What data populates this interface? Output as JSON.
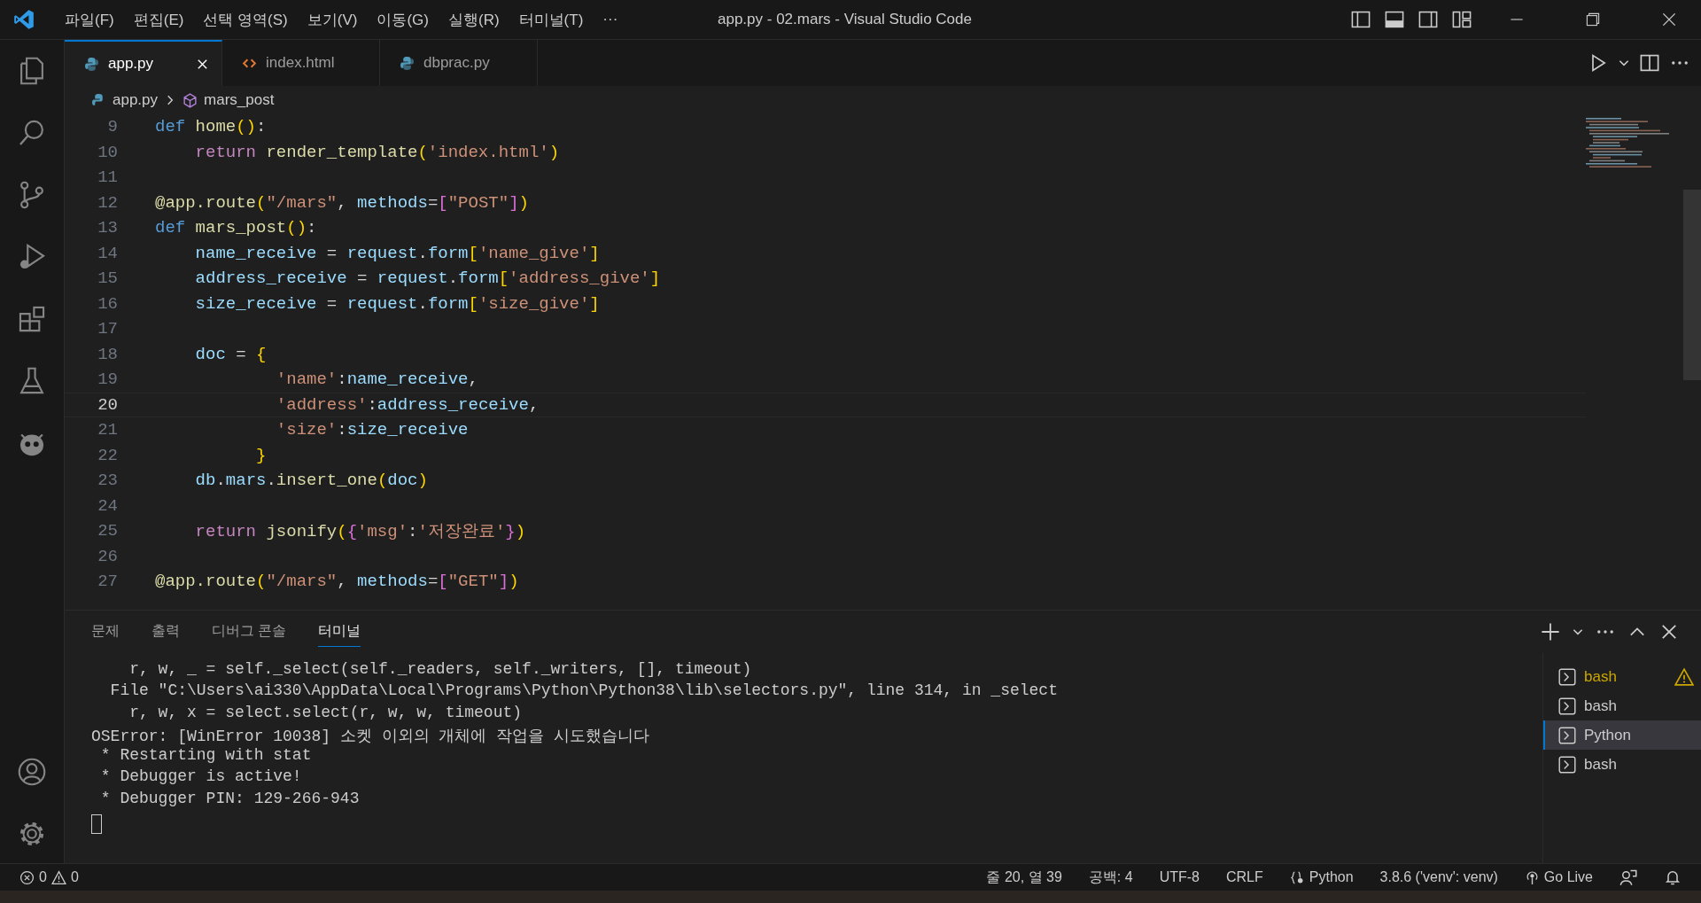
{
  "window": {
    "title": "app.py - 02.mars - Visual Studio Code"
  },
  "menu": [
    "파일(F)",
    "편집(E)",
    "선택 영역(S)",
    "보기(V)",
    "이동(G)",
    "실행(R)",
    "터미널(T)",
    "···"
  ],
  "tabs": [
    {
      "label": "app.py",
      "kind": "python",
      "selected": true
    },
    {
      "label": "index.html",
      "kind": "html",
      "selected": false
    },
    {
      "label": "dbprac.py",
      "kind": "python",
      "selected": false
    }
  ],
  "breadcrumb": {
    "file": "app.py",
    "symbol": "mars_post"
  },
  "code": [
    {
      "n": "9",
      "current": false,
      "tokens": [
        {
          "t": "def ",
          "kind": "kw"
        },
        {
          "t": "home",
          "kind": "fn"
        },
        {
          "t": "()",
          "kind": "br1"
        },
        {
          "t": ":",
          "kind": "plain"
        }
      ]
    },
    {
      "n": "10",
      "current": false,
      "tokens": [
        {
          "t": "    return ",
          "kind": "ctrl"
        },
        {
          "t": "render_template",
          "kind": "fn"
        },
        {
          "t": "(",
          "kind": "br1"
        },
        {
          "t": "'index.html'",
          "kind": "str"
        },
        {
          "t": ")",
          "kind": "br1"
        }
      ]
    },
    {
      "n": "11",
      "current": false
    },
    {
      "n": "12",
      "current": false,
      "tokens": [
        {
          "t": "@app.route",
          "kind": "fn"
        },
        {
          "t": "(",
          "kind": "br1"
        },
        {
          "t": "\"/mars\"",
          "kind": "str"
        },
        {
          "t": ", ",
          "kind": "plain"
        },
        {
          "t": "methods",
          "kind": "var"
        },
        {
          "t": "=",
          "kind": "plain"
        },
        {
          "t": "[",
          "kind": "br2"
        },
        {
          "t": "\"POST\"",
          "kind": "str"
        },
        {
          "t": "]",
          "kind": "br2"
        },
        {
          "t": ")",
          "kind": "br1"
        }
      ]
    },
    {
      "n": "13",
      "current": false,
      "tokens": [
        {
          "t": "def ",
          "kind": "kw"
        },
        {
          "t": "mars_post",
          "kind": "fn"
        },
        {
          "t": "()",
          "kind": "br1"
        },
        {
          "t": ":",
          "kind": "plain"
        }
      ]
    },
    {
      "n": "14",
      "current": false,
      "tokens": [
        {
          "t": "    name_receive",
          "kind": "var"
        },
        {
          "t": " = ",
          "kind": "plain"
        },
        {
          "t": "request",
          "kind": "var"
        },
        {
          "t": ".",
          "kind": "plain"
        },
        {
          "t": "form",
          "kind": "var"
        },
        {
          "t": "[",
          "kind": "br1"
        },
        {
          "t": "'name_give'",
          "kind": "str"
        },
        {
          "t": "]",
          "kind": "br1"
        }
      ]
    },
    {
      "n": "15",
      "current": false,
      "tokens": [
        {
          "t": "    address_receive",
          "kind": "var"
        },
        {
          "t": " = ",
          "kind": "plain"
        },
        {
          "t": "request",
          "kind": "var"
        },
        {
          "t": ".",
          "kind": "plain"
        },
        {
          "t": "form",
          "kind": "var"
        },
        {
          "t": "[",
          "kind": "br1"
        },
        {
          "t": "'address_give'",
          "kind": "str"
        },
        {
          "t": "]",
          "kind": "br1"
        }
      ]
    },
    {
      "n": "16",
      "current": false,
      "tokens": [
        {
          "t": "    size_receive",
          "kind": "var"
        },
        {
          "t": " = ",
          "kind": "plain"
        },
        {
          "t": "request",
          "kind": "var"
        },
        {
          "t": ".",
          "kind": "plain"
        },
        {
          "t": "form",
          "kind": "var"
        },
        {
          "t": "[",
          "kind": "br1"
        },
        {
          "t": "'size_give'",
          "kind": "str"
        },
        {
          "t": "]",
          "kind": "br1"
        }
      ]
    },
    {
      "n": "17",
      "current": false
    },
    {
      "n": "18",
      "current": false,
      "tokens": [
        {
          "t": "    doc",
          "kind": "var"
        },
        {
          "t": " = ",
          "kind": "plain"
        },
        {
          "t": "{",
          "kind": "br1"
        }
      ]
    },
    {
      "n": "19",
      "current": false,
      "tokens": [
        {
          "t": "            'name'",
          "kind": "str"
        },
        {
          "t": ":",
          "kind": "plain"
        },
        {
          "t": "name_receive",
          "kind": "var"
        },
        {
          "t": ",",
          "kind": "plain"
        }
      ]
    },
    {
      "n": "20",
      "current": true,
      "tokens": [
        {
          "t": "            'address'",
          "kind": "str"
        },
        {
          "t": ":",
          "kind": "plain"
        },
        {
          "t": "address_receive",
          "kind": "var"
        },
        {
          "t": ",",
          "kind": "plain"
        }
      ]
    },
    {
      "n": "21",
      "current": false,
      "tokens": [
        {
          "t": "            'size'",
          "kind": "str"
        },
        {
          "t": ":",
          "kind": "plain"
        },
        {
          "t": "size_receive",
          "kind": "var"
        }
      ]
    },
    {
      "n": "22",
      "current": false,
      "tokens": [
        {
          "t": "          }",
          "kind": "br1"
        }
      ]
    },
    {
      "n": "23",
      "current": false,
      "tokens": [
        {
          "t": "    db",
          "kind": "var"
        },
        {
          "t": ".",
          "kind": "plain"
        },
        {
          "t": "mars",
          "kind": "var"
        },
        {
          "t": ".",
          "kind": "plain"
        },
        {
          "t": "insert_one",
          "kind": "fn"
        },
        {
          "t": "(",
          "kind": "br1"
        },
        {
          "t": "doc",
          "kind": "var"
        },
        {
          "t": ")",
          "kind": "br1"
        }
      ]
    },
    {
      "n": "24",
      "current": false
    },
    {
      "n": "25",
      "current": false,
      "tokens": [
        {
          "t": "    return ",
          "kind": "ctrl"
        },
        {
          "t": "jsonify",
          "kind": "fn"
        },
        {
          "t": "(",
          "kind": "br1"
        },
        {
          "t": "{",
          "kind": "br2"
        },
        {
          "t": "'msg'",
          "kind": "str"
        },
        {
          "t": ":",
          "kind": "plain"
        },
        {
          "t": "'저장완료'",
          "kind": "str"
        },
        {
          "t": "}",
          "kind": "br2"
        },
        {
          "t": ")",
          "kind": "br1"
        }
      ]
    },
    {
      "n": "26",
      "current": false
    },
    {
      "n": "27",
      "current": false,
      "tokens": [
        {
          "t": "@app.route",
          "kind": "fn"
        },
        {
          "t": "(",
          "kind": "br1"
        },
        {
          "t": "\"/mars\"",
          "kind": "str"
        },
        {
          "t": ", ",
          "kind": "plain"
        },
        {
          "t": "methods",
          "kind": "var"
        },
        {
          "t": "=",
          "kind": "plain"
        },
        {
          "t": "[",
          "kind": "br2"
        },
        {
          "t": "\"GET\"",
          "kind": "str"
        },
        {
          "t": "]",
          "kind": "br2"
        },
        {
          "t": ")",
          "kind": "br1"
        }
      ]
    }
  ],
  "panel_tabs": [
    {
      "label": "문제",
      "selected": false
    },
    {
      "label": "출력",
      "selected": false
    },
    {
      "label": "디버그 콘솔",
      "selected": false
    },
    {
      "label": "터미널",
      "selected": true
    }
  ],
  "terminal": [
    "    r, w, _ = self._select(self._readers, self._writers, [], timeout)",
    "  File \"C:\\Users\\ai330\\AppData\\Local\\Programs\\Python\\Python38\\lib\\selectors.py\", line 314, in _select",
    "    r, w, x = select.select(r, w, w, timeout)",
    "OSError: [WinError 10038] 소켓 이외의 개체에 작업을 시도했습니다",
    " * Restarting with stat",
    " * Debugger is active!",
    " * Debugger PIN: 129-266-943"
  ],
  "terminals": [
    {
      "label": "bash",
      "selected": false,
      "warning": true
    },
    {
      "label": "bash",
      "selected": false,
      "warning": false
    },
    {
      "label": "Python",
      "selected": true,
      "warning": false
    },
    {
      "label": "bash",
      "selected": false,
      "warning": false
    }
  ],
  "status_bar": {
    "errors": "0",
    "warnings": "0",
    "items": [
      "줄 20, 열 39",
      "공백: 4",
      "UTF-8",
      "CRLF"
    ],
    "language": "Python",
    "interpreter": "3.8.6 ('venv': venv)",
    "live": "Go Live"
  }
}
